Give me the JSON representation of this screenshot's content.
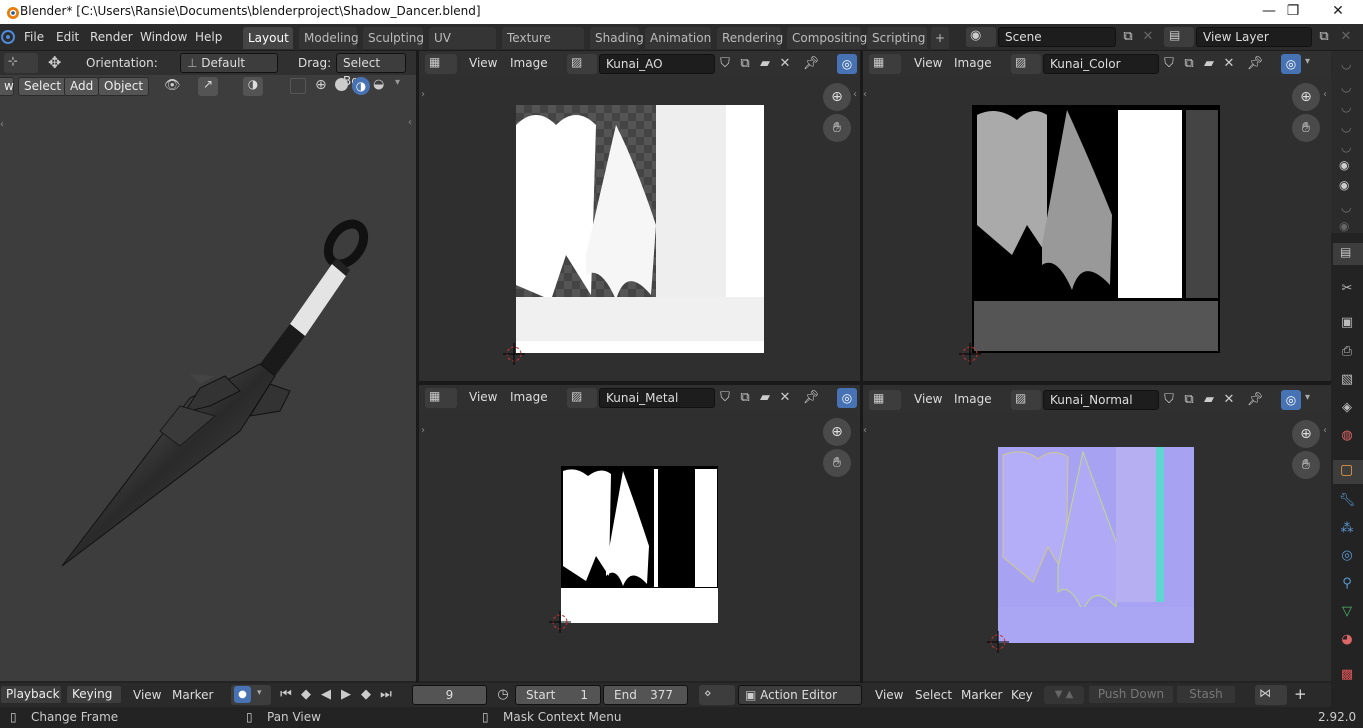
{
  "titlebar": {
    "title": "Blender* [C:\\Users\\Ransie\\Documents\\blenderproject\\Shadow_Dancer.blend]",
    "minimize": "—",
    "maximize": "❐",
    "close": "✕"
  },
  "menus": [
    "File",
    "Edit",
    "Render",
    "Window",
    "Help"
  ],
  "workspace_tabs": [
    "Layout",
    "Modeling",
    "Sculpting",
    "UV Editing",
    "Texture Paint",
    "Shading",
    "Animation",
    "Rendering",
    "Compositing",
    "Scripting"
  ],
  "active_tab": "Layout",
  "add_tab": "+",
  "scene": {
    "label": "Scene",
    "view_layer": "View Layer"
  },
  "viewport3d": {
    "orientation_label": "Orientation:",
    "orientation_value": "Default",
    "drag_label": "Drag:",
    "drag_value": "Select Box",
    "menu_view_partial": "w",
    "menu_select": "Select",
    "menu_add": "Add",
    "menu_object": "Object"
  },
  "image_editors": [
    {
      "id": "ao",
      "view": "View",
      "image": "Image",
      "image_name": "Kunai_AO"
    },
    {
      "id": "color",
      "view": "View",
      "image": "Image",
      "image_name": "Kunai_Color"
    },
    {
      "id": "metal",
      "view": "View",
      "image": "Image",
      "image_name": "Kunai_Metal"
    },
    {
      "id": "normal",
      "view": "View",
      "image": "Image",
      "image_name": "Kunai_Normal"
    }
  ],
  "timeline": {
    "playback": "Playback",
    "keying": "Keying",
    "view": "View",
    "marker": "Marker",
    "current_frame": "9",
    "start_label": "Start",
    "start_value": "1",
    "end_label": "End",
    "end_value": "377",
    "action_editor": "Action Editor",
    "ae_view": "View",
    "ae_select": "Select",
    "ae_marker": "Marker",
    "ae_key": "Key",
    "push_down": "Push Down",
    "stash": "Stash",
    "plus": "+"
  },
  "statusbar": {
    "change_frame": "Change Frame",
    "pan_view": "Pan View",
    "mask_context_menu": "Mask Context Menu",
    "version": "2.92.0"
  },
  "colors": {
    "accent_blue": "#4772b3",
    "tab_active": "#454545",
    "background": "#232323"
  }
}
